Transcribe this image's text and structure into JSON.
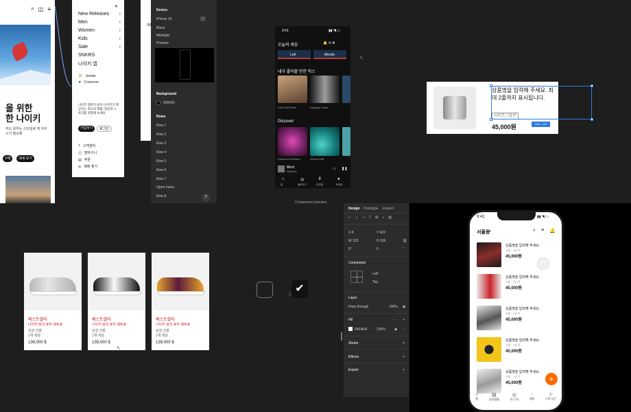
{
  "nike": {
    "headline_l1": "을 위한",
    "headline_l2": "한 나이키",
    "body": "어도 원하는 스타일로 에 아이스가 필요해",
    "btn_primary": "구매",
    "btn_secondary": "대세 보기"
  },
  "menu": {
    "items": [
      "New Releases",
      "Men",
      "Women",
      "Kids",
      "Sale",
      "SNKRS",
      "나이키 앱"
    ],
    "chevron": "›",
    "links": [
      "Jordan",
      "Converse"
    ],
    "blurb": "나이키 멤버가 되어 나이키가 제공하는 최고의 제품, 영감과 스토리를 경험해 보세요.",
    "join": "가입하기",
    "login": "로그인",
    "help": [
      "고객센터",
      "장바구니",
      "주문",
      "매장 찾기"
    ]
  },
  "props": {
    "section_device": "Device",
    "device": "iPhone 14",
    "opt1": "Black",
    "opt2": "Midnight",
    "preview": "Preview",
    "background": "Background",
    "bg_value": "000000",
    "rows_head": "Rows",
    "rows": [
      "Row 1",
      "Row 2",
      "Row 3",
      "Row 4",
      "Row 5",
      "Row 6",
      "Row 7"
    ],
    "open_menu": "Open menu",
    "row_8": "Row 8",
    "help": "?"
  },
  "music": {
    "time": "9:41",
    "title": "오늘의 세상",
    "chip1": "Lofi",
    "chip2": "Moods",
    "section2": "내가 좋아할 만한 믹스",
    "cap1": "Chill 2023 Plus",
    "cap2": "Subway Tunes",
    "section3": "Discover",
    "cap3": "Electronic Flowers",
    "cap4": "Ocean Drift",
    "now_title": "Mind",
    "now_artist": "Nutshell",
    "tabs": [
      "홈",
      "둘러보기",
      "보관함",
      "프로필"
    ]
  },
  "product": {
    "title": "상품명을 입력해 주세요. 최대 2줄까지 표시됩니다.",
    "option": "사이즈 / 옵션",
    "price": "45,000원",
    "size_badge": "156 × 120"
  },
  "shoes": [
    {
      "tag": "베스트셀러",
      "name": "나이키 덩크 로우 레트로",
      "sub1": "남성 신발",
      "sub2": "1개 색상",
      "price": "139,000 $"
    },
    {
      "tag": "베스트셀러",
      "name": "나이키 덩크 로우 레트로",
      "sub1": "남성 신발",
      "sub2": "1개 색상",
      "price": "139,000 $"
    },
    {
      "tag": "베스트셀러",
      "name": "나이키 덩크 로우 레트로",
      "sub1": "남성 신발",
      "sub2": "1개 색상",
      "price": "139,000 $"
    }
  ],
  "selection_caption": "Component selected",
  "design": {
    "tab_design": "Design",
    "tab_prototype": "Prototype",
    "tab_inspect": "Inspect",
    "x": "X 8",
    "y": "Y 422",
    "w": "W 123",
    "h": "H 106",
    "r": "0°",
    "radius": "0",
    "constraints": "Constraints",
    "left": "Left",
    "top": "Top",
    "layer": "Layer",
    "pass": "Pass through",
    "opacity": "100%",
    "fill": "Fill",
    "fill_hex": "FAFAFA",
    "fill_op": "100%",
    "stroke": "Stroke",
    "effects": "Effects",
    "export": "Export"
  },
  "phone": {
    "time": "9:41",
    "location": "서울동",
    "items": [
      {
        "title": "상품명을 입력해 주세요.",
        "sub": "서울 · 1분 전",
        "price": "45,000원"
      },
      {
        "title": "상품명을 입력해 주세요.",
        "sub": "서울 · 1분 전",
        "price": "45,000원"
      },
      {
        "title": "상품명을 입력해 주세요.",
        "sub": "서울 · 1분 전",
        "price": "45,000원"
      },
      {
        "title": "상품명을 입력해 주세요.",
        "sub": "서울 · 1분 전",
        "price": "45,000원"
      },
      {
        "title": "상품명을 입력해 주세요.",
        "sub": "서울 · 1분 전",
        "price": "45,000원"
      }
    ],
    "fab": "+",
    "tabs": [
      "홈",
      "동네생활",
      "내 근처",
      "채팅",
      "나의 당근"
    ]
  }
}
